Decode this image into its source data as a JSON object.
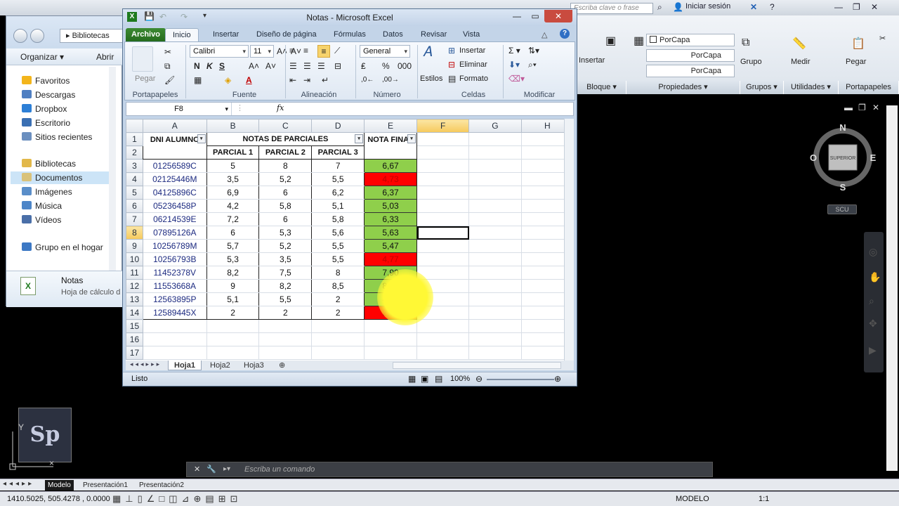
{
  "acad": {
    "search_placeholder": "Escriba clave o frase",
    "signin": "Iniciar sesión",
    "ribbon": {
      "insert_label": "Insertar",
      "layer_combo": "PorCapa",
      "linetype_combo": "PorCapa",
      "lineweight_combo": "PorCapa",
      "group_label": "Grupo",
      "measure_label": "Medir",
      "paste_label": "Pegar",
      "panels": [
        "Bloque",
        "Propiedades",
        "Grupos",
        "Utilidades",
        "Portapapeles"
      ]
    },
    "viewcube": {
      "n": "N",
      "s": "S",
      "e": "E",
      "w": "O",
      "face": "SUPERIOR"
    },
    "scu": "SCU",
    "command_placeholder": "Escriba un comando",
    "layout_tabs": [
      "Modelo",
      "Presentación1",
      "Presentación2"
    ],
    "coords": "1410.5025, 505.4278 , 0.0000",
    "modelo": "MODELO",
    "scale": "1:1",
    "logo_text": "Sp",
    "ucs_y": "Y"
  },
  "explorer": {
    "address": "Bibliotecas",
    "organize": "Organizar",
    "open": "Abrir",
    "nav": [
      {
        "label": "Favoritos",
        "icon": "star-icon",
        "color": "#f3b51c"
      },
      {
        "label": "Descargas",
        "icon": "downloads-icon",
        "color": "#4f7fc2"
      },
      {
        "label": "Dropbox",
        "icon": "dropbox-icon",
        "color": "#2d7fd6"
      },
      {
        "label": "Escritorio",
        "icon": "desktop-icon",
        "color": "#3a6fb3"
      },
      {
        "label": "Sitios recientes",
        "icon": "recent-icon",
        "color": "#6b8fbf"
      },
      {
        "label": "Bibliotecas",
        "icon": "library-icon",
        "color": "#e2b84a"
      },
      {
        "label": "Documentos",
        "icon": "documents-icon",
        "color": "#d9c27a"
      },
      {
        "label": "Imágenes",
        "icon": "images-icon",
        "color": "#5a8ec9"
      },
      {
        "label": "Música",
        "icon": "music-icon",
        "color": "#4d86c8"
      },
      {
        "label": "Vídeos",
        "icon": "videos-icon",
        "color": "#4a6fa8"
      },
      {
        "label": "Grupo en el hogar",
        "icon": "homegroup-icon",
        "color": "#3c78c4"
      }
    ],
    "details": {
      "name": "Notas",
      "type": "Hoja de cálculo d"
    }
  },
  "excel": {
    "title": "Notas  -  Microsoft Excel",
    "tabs": [
      "Archivo",
      "Inicio",
      "Insertar",
      "Diseño de página",
      "Fórmulas",
      "Datos",
      "Revisar",
      "Vista"
    ],
    "ribbon": {
      "paste": "Pegar",
      "font_name": "Calibri",
      "font_size": "11",
      "bold": "N",
      "italic": "K",
      "underline": "S",
      "number_format": "General",
      "styles": "Estilos",
      "insert": "Insertar",
      "delete": "Eliminar",
      "format": "Formato",
      "groups": [
        "Portapapeles",
        "Fuente",
        "Alineación",
        "Número",
        "Celdas",
        "Modificar"
      ]
    },
    "namebox": "F8",
    "fx": "fx",
    "columns": [
      "A",
      "B",
      "C",
      "D",
      "E",
      "F",
      "G",
      "H"
    ],
    "header1": {
      "col_a": "DNI ALUMNO",
      "group": "NOTAS DE PARCIALES",
      "col_e": "NOTA FINAL"
    },
    "header2": [
      "PARCIAL 1",
      "PARCIAL 2",
      "PARCIAL 3"
    ],
    "rows": [
      {
        "n": "3",
        "dni": "01256589C",
        "p1": "5",
        "p2": "8",
        "p3": "7",
        "final": "6,67",
        "pass": true
      },
      {
        "n": "4",
        "dni": "02125446M",
        "p1": "3,5",
        "p2": "5,2",
        "p3": "5,5",
        "final": "4,73",
        "pass": false
      },
      {
        "n": "5",
        "dni": "04125896C",
        "p1": "6,9",
        "p2": "6",
        "p3": "6,2",
        "final": "6,37",
        "pass": true
      },
      {
        "n": "6",
        "dni": "05236458P",
        "p1": "4,2",
        "p2": "5,8",
        "p3": "5,1",
        "final": "5,03",
        "pass": true
      },
      {
        "n": "7",
        "dni": "06214539E",
        "p1": "7,2",
        "p2": "6",
        "p3": "5,8",
        "final": "6,33",
        "pass": true
      },
      {
        "n": "8",
        "dni": "07895126A",
        "p1": "6",
        "p2": "5,3",
        "p3": "5,6",
        "final": "5,63",
        "pass": true
      },
      {
        "n": "9",
        "dni": "10256789M",
        "p1": "5,7",
        "p2": "5,2",
        "p3": "5,5",
        "final": "5,47",
        "pass": true
      },
      {
        "n": "10",
        "dni": "10256793B",
        "p1": "5,3",
        "p2": "3,5",
        "p3": "5,5",
        "final": "4,77",
        "pass": false
      },
      {
        "n": "11",
        "dni": "11452378V",
        "p1": "8,2",
        "p2": "7,5",
        "p3": "8",
        "final": "7,90",
        "pass": true
      },
      {
        "n": "12",
        "dni": "11553668A",
        "p1": "9",
        "p2": "8,2",
        "p3": "8,5",
        "final": "8,57",
        "pass": true
      },
      {
        "n": "13",
        "dni": "12563895P",
        "p1": "5,1",
        "p2": "5,5",
        "p3": "2",
        "final": "4,20",
        "pass": true
      },
      {
        "n": "14",
        "dni": "12589445X",
        "p1": "2",
        "p2": "2",
        "p3": "2",
        "final": "2,00",
        "pass": false
      }
    ],
    "empty_rows": [
      "15",
      "16",
      "17"
    ],
    "sheet_tabs": [
      "Hoja1",
      "Hoja2",
      "Hoja3"
    ],
    "status": "Listo",
    "zoom": "100%",
    "colors": {
      "pass": "#8fcf4b",
      "fail": "#ff0000",
      "fail_text": "#c00000"
    }
  }
}
